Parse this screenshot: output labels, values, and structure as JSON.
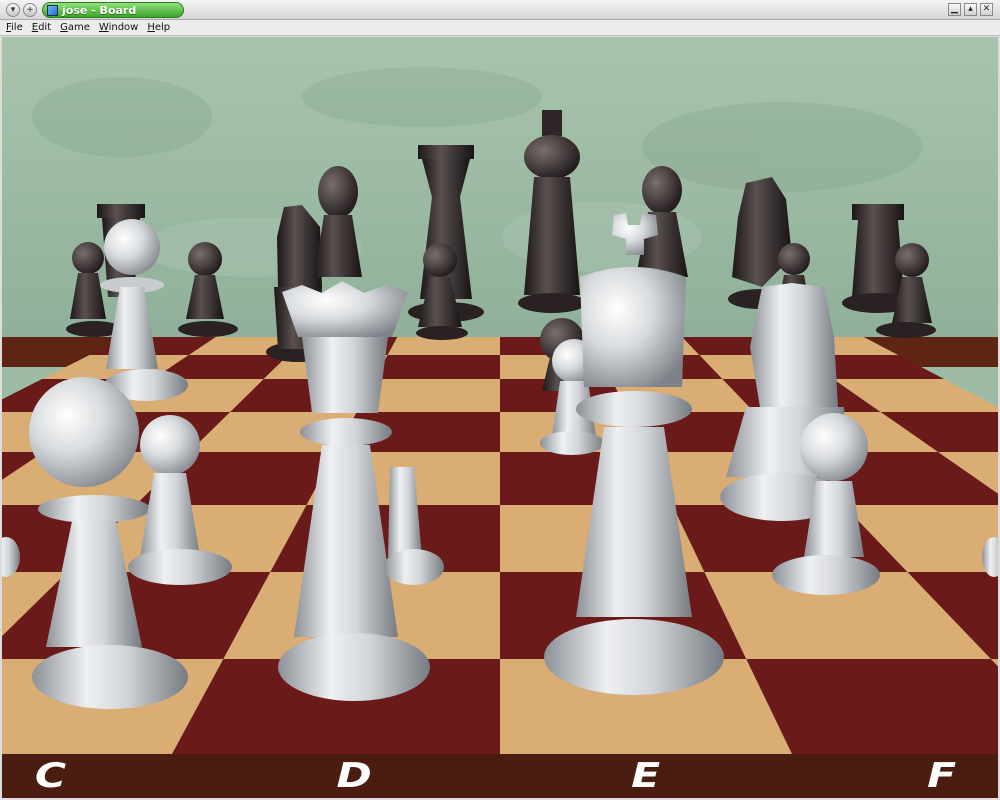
{
  "window": {
    "title": "jose - Board"
  },
  "menu": {
    "items": [
      "File",
      "Edit",
      "Game",
      "Window",
      "Help"
    ]
  },
  "board": {
    "file_labels": [
      "C",
      "D",
      "E",
      "F"
    ],
    "light_square_color": "#d9ad73",
    "dark_square_color": "#6b1a1a",
    "wall_color": "#9dbaa4",
    "white_piece_color": "#d9dcdf",
    "black_piece_color": "#2e2626"
  },
  "pieces": {
    "white": [
      "queen",
      "king",
      "knight",
      "pawn",
      "pawn",
      "pawn",
      "pawn",
      "pawn",
      "pawn"
    ],
    "black": [
      "king",
      "queen",
      "rook",
      "rook",
      "bishop",
      "bishop",
      "knight",
      "knight",
      "pawn",
      "pawn",
      "pawn",
      "pawn",
      "pawn"
    ]
  }
}
